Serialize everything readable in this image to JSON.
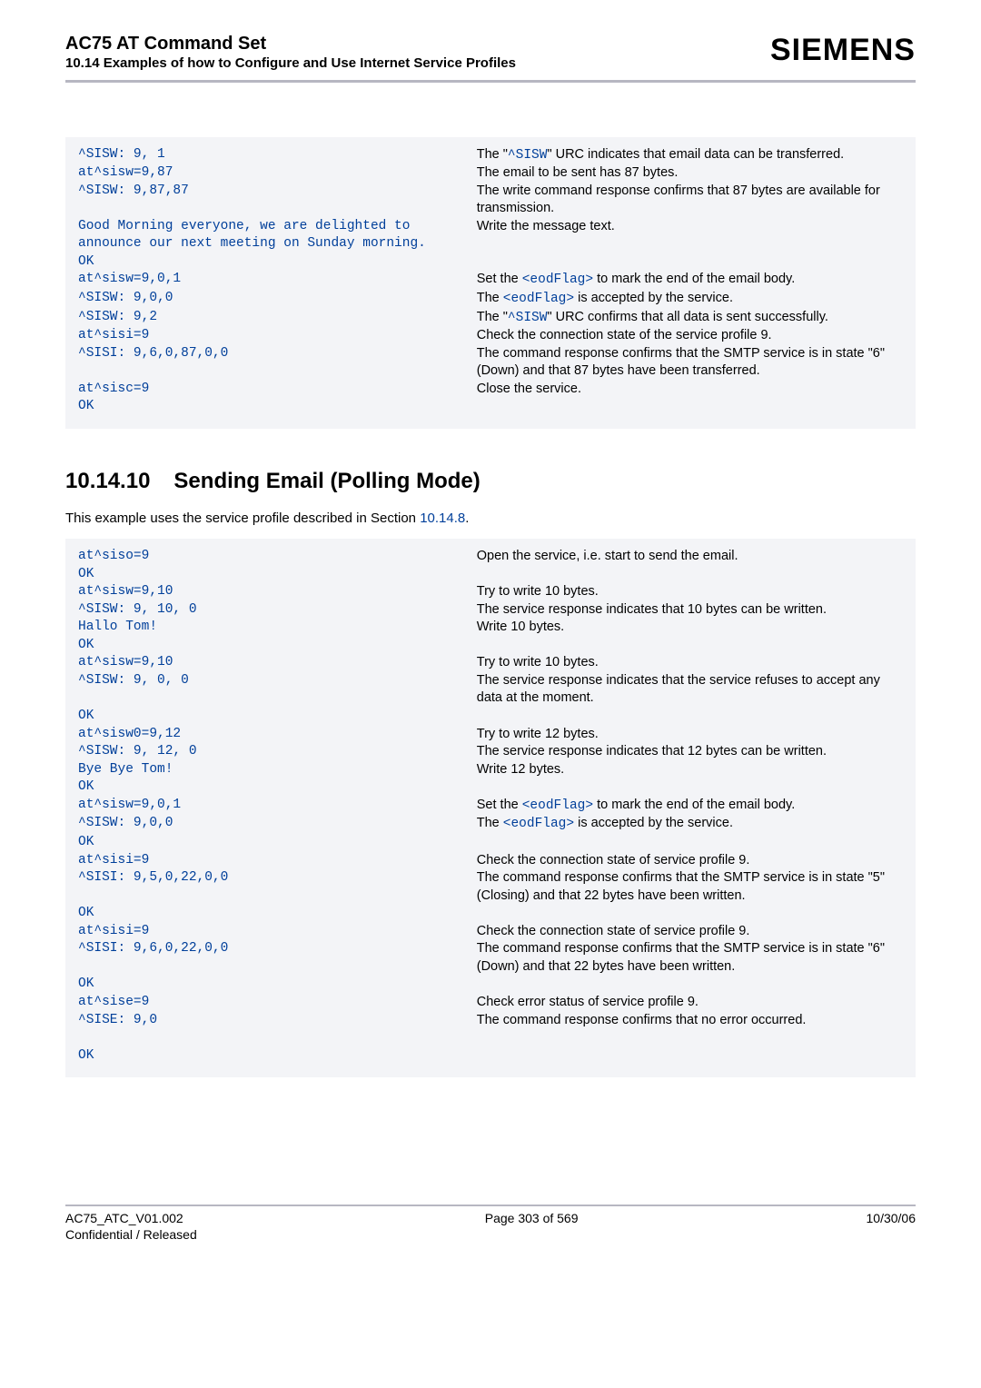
{
  "header": {
    "doc_title": "AC75 AT Command Set",
    "doc_subtitle": "10.14 Examples of how to Configure and Use Internet Service Profiles",
    "brand": "SIEMENS"
  },
  "block1": {
    "rows": [
      {
        "cmd": "^SISW: 9, 1",
        "desc_pre": "The \"",
        "desc_code": "^SISW",
        "desc_post": "\" URC indicates that email data can be transferred."
      },
      {
        "cmd": "at^sisw=9,87",
        "desc": "The email to be sent has 87 bytes."
      },
      {
        "cmd": "^SISW: 9,87,87",
        "desc": "The write command response confirms that 87 bytes are available for transmission."
      },
      {
        "cmd": "Good Morning everyone, we are delighted to announce our next meeting on Sunday morning.",
        "desc": "Write the message text."
      },
      {
        "cmd": "OK",
        "desc": ""
      },
      {
        "cmd": "at^sisw=9,0,1",
        "desc_pre": "Set the ",
        "desc_code": "<eodFlag>",
        "desc_post": " to mark the end of the email body."
      },
      {
        "cmd": "^SISW: 9,0,0",
        "desc_pre": "The ",
        "desc_code": "<eodFlag>",
        "desc_post": " is accepted by the service."
      },
      {
        "cmd": "^SISW: 9,2",
        "desc_pre": "The \"",
        "desc_code": "^SISW",
        "desc_post": "\" URC confirms that all data is sent successfully."
      },
      {
        "cmd": "at^sisi=9",
        "desc": "Check the connection state of the service profile 9."
      },
      {
        "cmd": "^SISI: 9,6,0,87,0,0",
        "desc": "The command response confirms that the SMTP service is in state \"6\" (Down) and that 87 bytes have been transferred."
      },
      {
        "cmd": "at^sisc=9",
        "desc": "Close the service."
      },
      {
        "cmd": "OK",
        "desc": ""
      }
    ]
  },
  "section": {
    "num": "10.14.10",
    "title": "Sending Email (Polling Mode)",
    "intro_pre": "This example uses the service profile described in Section ",
    "intro_link": "10.14.8",
    "intro_post": "."
  },
  "block2": {
    "rows": [
      {
        "cmd": "at^siso=9",
        "desc": "Open the service, i.e. start to send the email."
      },
      {
        "cmd": "OK",
        "desc": ""
      },
      {
        "cmd": "at^sisw=9,10",
        "desc": "Try to write 10 bytes."
      },
      {
        "cmd": "^SISW: 9, 10, 0",
        "desc": "The service response indicates that 10 bytes can be written."
      },
      {
        "cmd": "Hallo Tom!",
        "desc": "Write 10 bytes."
      },
      {
        "cmd": "OK",
        "desc": ""
      },
      {
        "cmd": "at^sisw=9,10",
        "desc": "Try to write 10 bytes."
      },
      {
        "cmd": "^SISW: 9, 0, 0",
        "desc": "The service response indicates that the service refuses to accept any data at the moment."
      },
      {
        "cmd": "OK",
        "desc": ""
      },
      {
        "cmd": "at^sisw0=9,12",
        "desc": "Try to write 12 bytes."
      },
      {
        "cmd": "^SISW: 9, 12, 0",
        "desc": "The service response indicates that 12 bytes can be written."
      },
      {
        "cmd": "Bye Bye Tom!",
        "desc": "Write 12 bytes."
      },
      {
        "cmd": "OK",
        "desc": ""
      },
      {
        "cmd": "at^sisw=9,0,1",
        "desc_pre": "Set the ",
        "desc_code": "<eodFlag>",
        "desc_post": " to mark the end of the email body."
      },
      {
        "cmd": "^SISW: 9,0,0",
        "desc_pre": "The ",
        "desc_code": "<eodFlag>",
        "desc_post": " is accepted by the service."
      },
      {
        "cmd": "OK",
        "desc": ""
      },
      {
        "cmd": "at^sisi=9",
        "desc": "Check the connection state of service profile 9."
      },
      {
        "cmd": "^SISI: 9,5,0,22,0,0",
        "desc": "The command response confirms that the SMTP service is in state \"5\" (Closing) and that 22 bytes have been written."
      },
      {
        "cmd": "OK",
        "desc": ""
      },
      {
        "cmd": "at^sisi=9",
        "desc": "Check the connection state of service profile 9."
      },
      {
        "cmd": "^SISI: 9,6,0,22,0,0",
        "desc": "The command response confirms that the SMTP service is in state \"6\" (Down) and that 22 bytes have been written."
      },
      {
        "cmd": "OK",
        "desc": ""
      },
      {
        "cmd": "at^sise=9",
        "desc": "Check error status of service profile 9."
      },
      {
        "cmd": "^SISE: 9,0",
        "desc": "The command response confirms that no error occurred."
      },
      {
        "cmd": "",
        "desc": ""
      },
      {
        "cmd": "OK",
        "desc": ""
      }
    ]
  },
  "footer": {
    "left1": "AC75_ATC_V01.002",
    "left2": "Confidential / Released",
    "center": "Page 303 of 569",
    "right": "10/30/06"
  }
}
